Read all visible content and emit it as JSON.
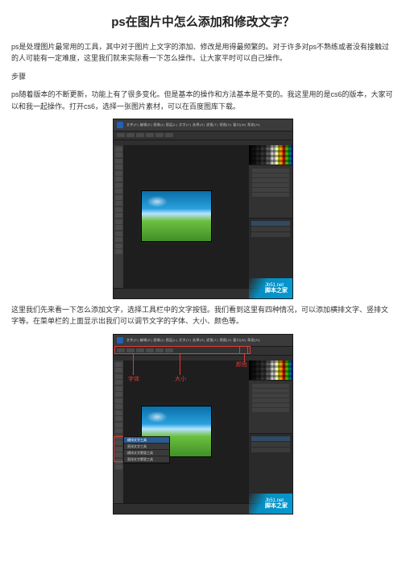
{
  "title": "ps在图片中怎么添加和修改文字？",
  "para1": "ps是处理图片最常用的工具，其中对于图片上文字的添加、修改是用得最频繁的。对于许多对ps不熟练或者没有接触过的人可能有一定难度，这里我们就来实际看一下怎么操作。让大家平时可以自己操作。",
  "steps_label": "步骤",
  "para2": "ps随着版本的不断更新，功能上有了很多变化。但是基本的操作和方法基本是不变的。我这里用的是cs6的版本，大家可以和我一起操作。打开cs6，选择一张图片素材，可以在百度图库下载。",
  "para3": "这里我们先来看一下怎么添加文字，选择工具栏中的文字按钮。我们看到这里有四种情况，可以添加横排文字、竖排文字等。在菜单栏的上面显示出我们可以调节文字的字体、大小、颜色等。",
  "ps_menu": "文件(F)  编辑(E)  图像(I)  图层(L)  文字(Y)  选择(S)  滤镜(T)  视图(V)  窗口(W)  帮助(H)",
  "watermark_small": "Jb51.net",
  "watermark_big": "脚本之家",
  "anno": {
    "font_label": "字体",
    "size_label": "大小",
    "color_label": "颜色"
  },
  "text_tool_menu": {
    "items": [
      "横排文字工具",
      "直排文字工具",
      "横排文字蒙版工具",
      "直排文字蒙版工具"
    ]
  }
}
